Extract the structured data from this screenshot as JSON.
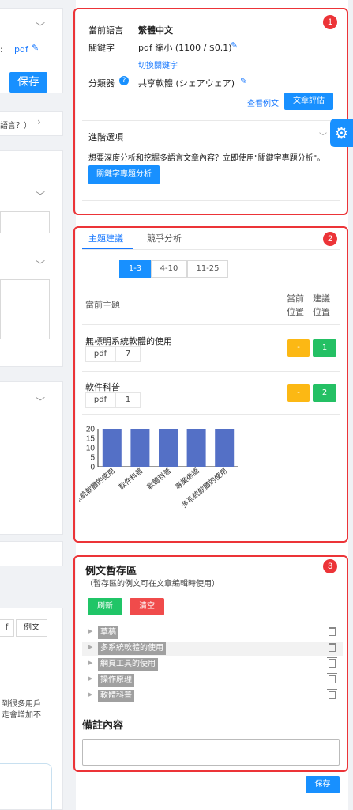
{
  "left": {
    "pdf_link": "pdf",
    "save_label": "保存",
    "prompt_text": "語言？）",
    "tab_f": "f",
    "tab_example": "例文",
    "snippet_line1": "到很多用戶",
    "snippet_line2": "走會增加不"
  },
  "panel1": {
    "badge": "1",
    "lang_label": "當前語言",
    "lang_value": "繁體中文",
    "keyword_label": "關鍵字",
    "keyword_value": "pdf 縮小 (1100 / $0.1)",
    "switch_keyword": "切換關鍵字",
    "classifier_label": "分類器",
    "classifier_value": "共享軟體 (シェアウェア)",
    "view_example": "查看例文",
    "evaluate_button": "文章評估",
    "advanced_label": "進階選項",
    "advanced_desc": "想要深度分析和挖掘多語言文章內容？立即使用\"關鍵字專題分析\"。",
    "topic_analysis_button": "關鍵字專題分析"
  },
  "panel2": {
    "badge": "2",
    "tabs": [
      "主題建議",
      "競爭分析"
    ],
    "ranges": [
      "1-3",
      "4-10",
      "11-25"
    ],
    "col_topic": "當前主題",
    "col_current_1": "當前",
    "col_current_2": "位置",
    "col_suggest_1": "建議",
    "col_suggest_2": "位置",
    "topics": [
      {
        "name": "無標明系統軟體的使用",
        "tag": "pdf",
        "count": "7",
        "current": "-",
        "suggest": "1"
      },
      {
        "name": "軟件科普",
        "tag": "pdf",
        "count": "1",
        "current": "-",
        "suggest": "2"
      }
    ]
  },
  "chart_data": {
    "type": "bar",
    "categories": [
      "系統軟體的使用",
      "軟件科普",
      "軟體科普",
      "專業術語",
      "多系統軟體的使用"
    ],
    "values": [
      20,
      20,
      20,
      20,
      20
    ],
    "ylim": [
      0,
      20
    ],
    "yticks": [
      "20",
      "15",
      "10",
      "5",
      "0"
    ],
    "color": "#5470c6"
  },
  "panel3": {
    "badge": "3",
    "title": "例文暫存區",
    "subtitle": "（暫存區的例文可在文章編輯時使用）",
    "refresh_button": "刷新",
    "clear_button": "清空",
    "items": [
      "草稿",
      "多系統軟體的使用",
      "網頁工具的使用",
      "操作原理",
      "軟體科普"
    ],
    "notes_title": "備註內容",
    "save_button": "保存"
  },
  "colors": {
    "accent": "#1890ff",
    "highlight": "#ec3438",
    "green": "#20c567",
    "orange": "#fcb814"
  }
}
